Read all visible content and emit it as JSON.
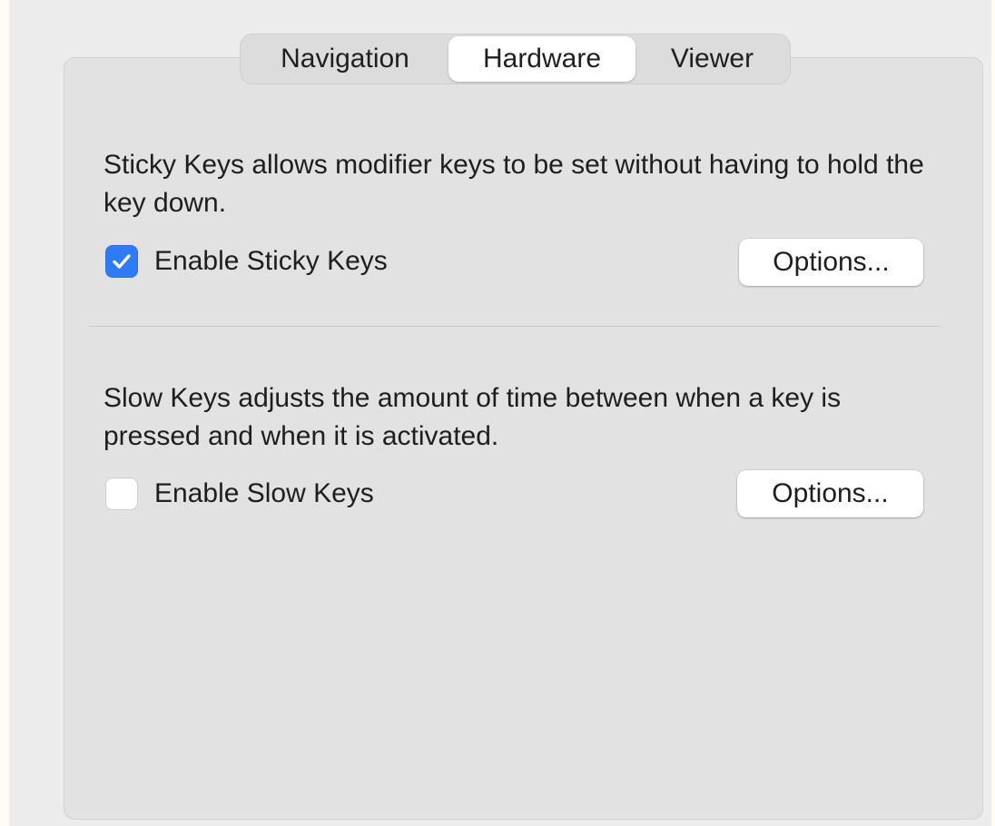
{
  "tabs": [
    {
      "label": "Navigation",
      "selected": false
    },
    {
      "label": "Hardware",
      "selected": true
    },
    {
      "label": "Viewer",
      "selected": false
    }
  ],
  "sticky_keys": {
    "description": "Sticky Keys allows modifier keys to be set without having to hold the key down.",
    "checkbox_label": "Enable Sticky Keys",
    "checked": true,
    "options_label": "Options..."
  },
  "slow_keys": {
    "description": "Slow Keys adjusts the amount of time between when a key is pressed and when it is activated.",
    "checkbox_label": "Enable Slow Keys",
    "checked": false,
    "options_label": "Options..."
  },
  "colors": {
    "accent": "#2f7bf6",
    "panel_background": "#e2e2e2"
  }
}
